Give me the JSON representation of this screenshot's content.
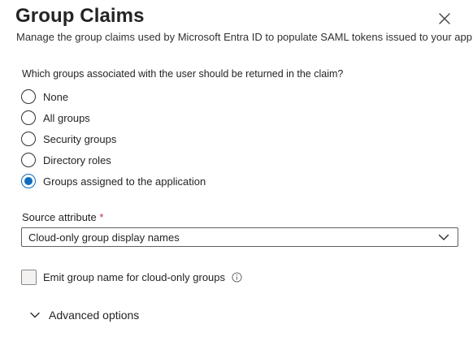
{
  "header": {
    "title": "Group Claims",
    "subtitle": "Manage the group claims used by Microsoft Entra ID to populate SAML tokens issued to your app"
  },
  "question": "Which groups associated with the user should be returned in the claim?",
  "radio_options": [
    {
      "label": "None",
      "checked": false
    },
    {
      "label": "All groups",
      "checked": false
    },
    {
      "label": "Security groups",
      "checked": false
    },
    {
      "label": "Directory roles",
      "checked": false
    },
    {
      "label": "Groups assigned to the application",
      "checked": true
    }
  ],
  "source_attribute": {
    "label": "Source attribute",
    "required_marker": "*",
    "value": "Cloud-only group display names"
  },
  "checkbox": {
    "label": "Emit group name for cloud-only groups",
    "checked": false
  },
  "advanced": {
    "label": "Advanced options",
    "expanded": false
  },
  "icons": {
    "close": "close-icon",
    "dropdown": "chevron-down-icon",
    "info": "info-icon",
    "expand": "chevron-down-icon"
  },
  "colors": {
    "accent": "#0f6cbd",
    "required": "#c4314b",
    "text": "#242424"
  }
}
